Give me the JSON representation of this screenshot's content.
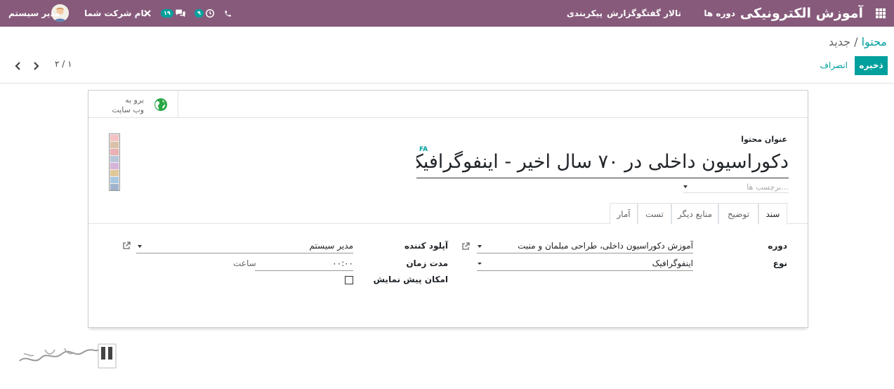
{
  "navbar": {
    "brand": "آموزش الکترونیکی",
    "menu": [
      "دوره ها",
      "تالار گفتگو",
      "گزارش",
      "پیکربندی"
    ],
    "user_name": "مدیر سیستم",
    "company_name": "نام شرکت شما",
    "messages_count": "۱۹",
    "activities_count": "۹"
  },
  "breadcrumb": {
    "parent": "محتوا",
    "separator": "/",
    "current": "جدید"
  },
  "buttons": {
    "save": "ذخیره",
    "discard": "انصراف"
  },
  "pager": {
    "value": "۲ / ۱"
  },
  "website_button": {
    "line1": "برو به",
    "line2": "وب سایت"
  },
  "form": {
    "title_label": "عنوان محتوا",
    "title": "دکوراسیون داخلی در ۷۰ سال اخیر - اینفوگرافیک",
    "lang": "FA",
    "tags_placeholder": "برچسب ها..."
  },
  "tabs": [
    "سند",
    "توضیح",
    "منابع دیگر",
    "تست",
    "آمار"
  ],
  "fields": {
    "course_label": "دوره",
    "course_value": "آموزش دکوراسیون داخلی، طراحی مبلمان و منبت",
    "type_label": "نوع",
    "type_value": "اینفوگرافیک",
    "uploader_label": "آپلود کننده",
    "uploader_value": "مدیر سیستم",
    "duration_label": "مدت زمان",
    "duration_value": "۰۰:۰۰",
    "duration_unit": "ساعت",
    "preview_label": "امکان پیش نمایش"
  },
  "colors": {
    "navbar": "#875a7b",
    "accent": "#00a09d"
  }
}
